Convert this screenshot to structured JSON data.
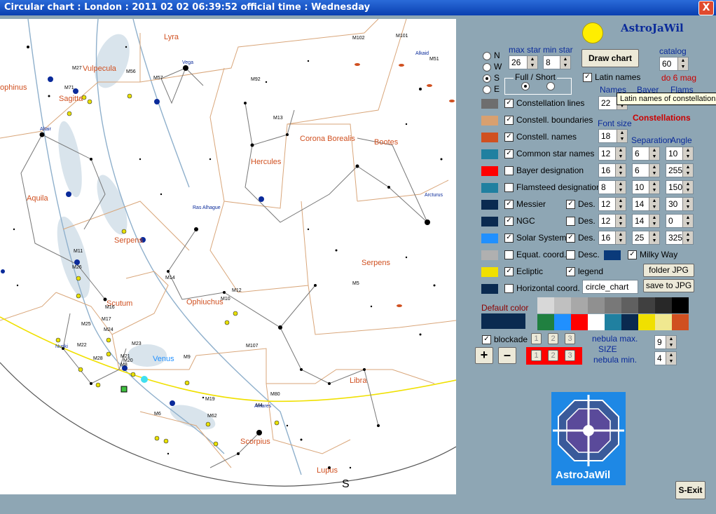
{
  "window": {
    "title": "Circular chart  :  London  :  2011 02 02   06:39:52  official time  :  Wednesday",
    "close_glyph": "X"
  },
  "chart": {
    "constellations": [
      "Lyra",
      "Vulpecula",
      "Sagitta",
      "Aquila",
      "Corona Borealis",
      "Bootes",
      "Hercules",
      "Serpens",
      "Serpens",
      "Ophiuchus",
      "Scutum",
      "Libra",
      "Scorpius",
      "Lupus",
      "ophinus"
    ],
    "objects": [
      "M102",
      "M101",
      "M51",
      "M27",
      "M56",
      "M57",
      "M92",
      "M13",
      "M71",
      "M11",
      "M26",
      "M14",
      "M12",
      "M10",
      "M5",
      "M107",
      "M16",
      "M17",
      "M25",
      "M24",
      "M22",
      "M28",
      "M21",
      "M20",
      "M23",
      "M8",
      "M9",
      "M80",
      "M4",
      "M19",
      "M62",
      "M6"
    ],
    "stars": [
      "Vega",
      "Altair",
      "Arcturus",
      "Ras Alhague",
      "Antares",
      "Nunki",
      "Alkaid"
    ],
    "venus": "Venus",
    "south": "S"
  },
  "panel": {
    "app_name": "AstroJaWil",
    "max_star_label": "max star",
    "min_star_label": "min star",
    "max_star": "26",
    "min_star": "8",
    "draw_chart": "Draw chart",
    "catalog_label": "catalog",
    "catalog": "60",
    "mag_note": "do 6 mag",
    "directions": [
      "N",
      "W",
      "S",
      "E"
    ],
    "selected_direction": "S",
    "full_short_label": "Full / Short",
    "latin_names": "Latin names",
    "names_col": "Names",
    "bayer_col": "Bayer",
    "flams_col": "Flams",
    "names_value": "22",
    "tooltip": "Latin names of constellations",
    "constellations_header": "Constellations",
    "font_size_label": "Font size",
    "font_size": "18",
    "separation_label": "Separation",
    "angle_label": "Angle",
    "rows": [
      {
        "label": "Constellation lines",
        "color": "#6e6e6e",
        "checked": true
      },
      {
        "label": "Constell. boundaries",
        "color": "#d8a070",
        "checked": true
      },
      {
        "label": "Constell. names",
        "color": "#d05020",
        "checked": true
      },
      {
        "label": "Common star names",
        "color": "#2080a0",
        "checked": true,
        "f": "12",
        "s": "6",
        "a": "10"
      },
      {
        "label": "Bayer designation",
        "color": "#ff0000",
        "checked": false,
        "f": "16",
        "s": "6",
        "a": "255"
      },
      {
        "label": "Flamsteed designation",
        "color": "#2080a0",
        "checked": false,
        "f": "8",
        "s": "10",
        "a": "150"
      },
      {
        "label": "Messier",
        "color": "#0a2a50",
        "checked": true,
        "des": true,
        "f": "12",
        "s": "14",
        "a": "30"
      },
      {
        "label": "NGC",
        "color": "#0a2a50",
        "checked": true,
        "des": false,
        "f": "12",
        "s": "14",
        "a": "0"
      },
      {
        "label": "Solar System",
        "color": "#2090ff",
        "checked": true,
        "des": true,
        "f": "16",
        "s": "25",
        "a": "325"
      },
      {
        "label": "Equat. coord.",
        "color": "#b0b0b0",
        "checked": false
      },
      {
        "label": "Ecliptic",
        "color": "#f0e000",
        "checked": true
      },
      {
        "label": "Horizontal coord.",
        "color": "#0a2a50",
        "checked": false
      }
    ],
    "des_label": "Des.",
    "desc_label": "Desc.",
    "milky_way": "Milky Way",
    "legend": "legend",
    "folder_jpg": "folder JPG",
    "save_jpg": "save to JPG",
    "filename": "circle_chart",
    "default_color": "Default color",
    "palette_top": [
      "#d8d8d8",
      "#c0c0c0",
      "#a8a8a8",
      "#909090",
      "#787878",
      "#606060",
      "#404040",
      "#282828",
      "#000000"
    ],
    "palette_bottom": [
      "#208040",
      "#2090ff",
      "#ff0000",
      "#ffffff",
      "#2080a0",
      "#0a2a50",
      "#f0e000",
      "#f0e890",
      "#d05020"
    ],
    "blockade": "blockade",
    "blockade_buttons": [
      "1",
      "2",
      "3"
    ],
    "nebula_max_label": "nebula max.",
    "size_label": "SIZE",
    "nebula_min_label": "nebula min.",
    "nebula_max": "9",
    "nebula_min": "4",
    "plus": "+",
    "minus": "–",
    "logo_text": "AstroJaWil",
    "exit": "S-Exit"
  }
}
